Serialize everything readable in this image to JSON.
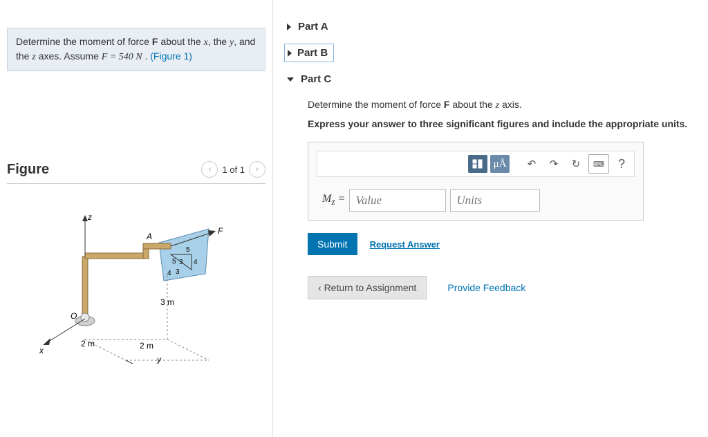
{
  "problem": {
    "prefix": "Determine the moment of force ",
    "force_sym": "F",
    "mid1": " about the ",
    "x_sym": "x",
    "mid2": ", the ",
    "y_sym": "y",
    "mid3": ", and the ",
    "z_sym": "z",
    "mid4": " axes. Assume ",
    "eq": "F = 540 N",
    "dot": " . ",
    "fig_link": "(Figure 1)"
  },
  "figure": {
    "title": "Figure",
    "pager": "1 of 1",
    "labels": {
      "z": "z",
      "A": "A",
      "F": "F",
      "O": "O",
      "x": "x",
      "y": "y",
      "d3m": "3 m",
      "d2m": "2 m",
      "n5": "5",
      "n4": "4",
      "n3": "3"
    }
  },
  "parts": {
    "a": "Part A",
    "b": "Part B",
    "c": "Part C"
  },
  "partC": {
    "q_prefix": "Determine the moment of force ",
    "q_force": "F",
    "q_mid": " about the ",
    "q_axis": "z",
    "q_suffix": " axis.",
    "instruct": "Express your answer to three significant figures and include the appropriate units.",
    "label": "M",
    "sub": "z",
    "eq": " = ",
    "value_ph": "Value",
    "units_ph": "Units",
    "submit": "Submit",
    "request": "Request Answer",
    "tb": {
      "mu": "μÅ",
      "undo": "↶",
      "redo": "↷",
      "reset": "↻",
      "kb": "⌨",
      "help": "?"
    }
  },
  "footer": {
    "return": "Return to Assignment",
    "feedback": "Provide Feedback"
  }
}
